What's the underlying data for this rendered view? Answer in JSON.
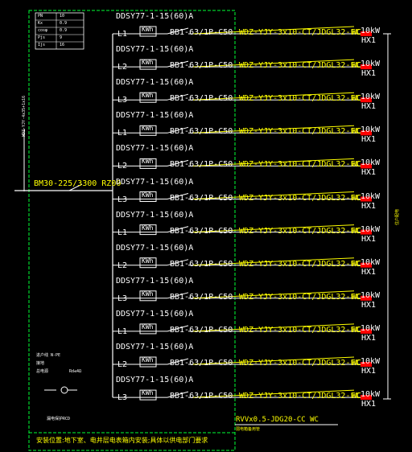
{
  "legend_table": [
    [
      "PN",
      "10"
    ],
    [
      "Kx",
      "0.9"
    ],
    [
      "cosφ",
      "0.9"
    ],
    [
      "Pjs",
      "9"
    ],
    [
      "Ijs",
      "16"
    ]
  ],
  "incoming": {
    "breaker": "BM30-225/3300 RZ00",
    "cable_label": "WDZ-YJY-4x35+1x16"
  },
  "circuits": [
    {
      "meter": "DDSY77-1-15(60)A",
      "phase": "L1",
      "kwh": "KWh",
      "breaker": "BB1-63/1P-C50",
      "cable": "WDZ-YJY-3x10-CT/JDGL32-FC",
      "wc": "WC",
      "kw": "10kW",
      "load": "HX1"
    },
    {
      "meter": "DDSY77-1-15(60)A",
      "phase": "L2",
      "kwh": "KWh",
      "breaker": "BB1-63/1P-C50",
      "cable": "WDZ-YJY-3x10-CT/JDGL32-FC",
      "wc": "WC",
      "kw": "10kW",
      "load": "HX1"
    },
    {
      "meter": "DDSY77-1-15(60)A",
      "phase": "L3",
      "kwh": "KWh",
      "breaker": "BB1-63/1P-C50",
      "cable": "WDZ-YJY-3x10-CT/JDGL32-FC",
      "wc": "WC",
      "kw": "10kW",
      "load": "HX1"
    },
    {
      "meter": "DDSY77-1-15(60)A",
      "phase": "L1",
      "kwh": "KWh",
      "breaker": "BB1-63/1P-C50",
      "cable": "WDZ-YJY-3x10-CT/JDGL32-FC",
      "wc": "WC",
      "kw": "10kW",
      "load": "HX1"
    },
    {
      "meter": "DDSY77-1-15(60)A",
      "phase": "L2",
      "kwh": "KWh",
      "breaker": "BB1-63/1P-C50",
      "cable": "WDZ-YJY-3x10-CT/JDGL32-FC",
      "wc": "WC",
      "kw": "10kW",
      "load": "HX1"
    },
    {
      "meter": "DDSY77-1-15(60)A",
      "phase": "L3",
      "kwh": "KWh",
      "breaker": "BB1-63/1P-C50",
      "cable": "WDZ-YJY-3x10-CT/JDGL32-FC",
      "wc": "WC",
      "kw": "10kW",
      "load": "HX1"
    },
    {
      "meter": "DDSY77-1-15(60)A",
      "phase": "L1",
      "kwh": "KWh",
      "breaker": "BB1-63/1P-C50",
      "cable": "WDZ-YJY-3x10-CT/JDGL32-FC",
      "wc": "WC",
      "kw": "10kW",
      "load": "HX1"
    },
    {
      "meter": "DDSY77-1-15(60)A",
      "phase": "L2",
      "kwh": "KWh",
      "breaker": "BB1-63/1P-C50",
      "cable": "WDZ-YJY-3x10-CT/JDGL32-FC",
      "wc": "WC",
      "kw": "10kW",
      "load": "HX1"
    },
    {
      "meter": "DDSY77-1-15(60)A",
      "phase": "L3",
      "kwh": "KWh",
      "breaker": "BB1-63/1P-C50",
      "cable": "WDZ-YJY-3x10-CT/JDGL32-FC",
      "wc": "WC",
      "kw": "10kW",
      "load": "HX1"
    },
    {
      "meter": "DDSY77-1-15(60)A",
      "phase": "L1",
      "kwh": "KWh",
      "breaker": "BB1-63/1P-C50",
      "cable": "WDZ-YJY-3x10-CT/JDGL32-FC",
      "wc": "WC",
      "kw": "10kW",
      "load": "HX1"
    },
    {
      "meter": "DDSY77-1-15(60)A",
      "phase": "L2",
      "kwh": "KWh",
      "breaker": "BB1-63/1P-C50",
      "cable": "WDZ-YJY-3x10-CT/JDGL32-FC",
      "wc": "WC",
      "kw": "10kW",
      "load": "HX1"
    },
    {
      "meter": "DDSY77-1-15(60)A",
      "phase": "L3",
      "kwh": "KWh",
      "breaker": "BB1-63/1P-C50",
      "cable": "WDZ-YJY-3x10-CT/JDGL32-FC",
      "wc": "WC",
      "kw": "10kW",
      "load": "HX1"
    }
  ],
  "spare_cable": "RVVx0.5-JDG20-CC WC",
  "right_bracket_label": "住户配电",
  "notes": {
    "line1": "进户线 N-PE",
    "line2": "接地",
    "line3": "总电源",
    "line4": "Rd≤4Ω",
    "bottom_small": "漏电保护RCD",
    "spare_caption": "弱电箱备用管"
  },
  "bottom_note": "安装位置:地下室、电井层电表箱内安装;具体以供电部门要求",
  "colors": {
    "background": "#000000",
    "line": "#ffffff",
    "border": "#00ff33",
    "highlight": "#ffff00",
    "marker": "#ff0000",
    "breaker": "#ff3333"
  }
}
